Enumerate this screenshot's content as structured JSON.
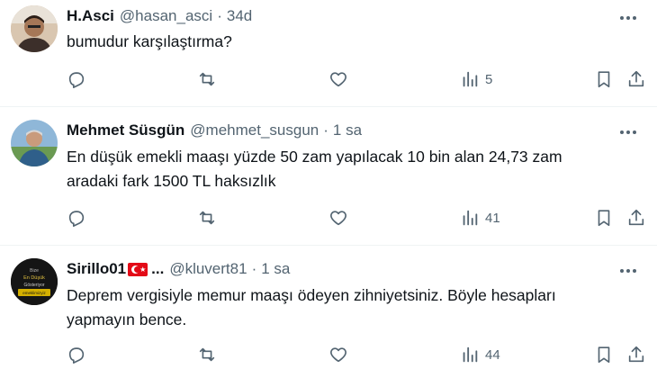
{
  "tweets": [
    {
      "name": "H.Asci",
      "handle": "@hasan_asci",
      "dot": "·",
      "time": "34d",
      "text": "bumudur karşılaştırma?",
      "views": "5"
    },
    {
      "name": "Mehmet Süsgün",
      "handle": "@mehmet_susgun",
      "dot": "·",
      "time": "1 sa",
      "text_line1": "En düşük emekli maaşı yüzde 50 zam yapılacak 10 bin alan 24,73 zam",
      "text_line2": "aradaki fark 1500 TL haksızlık",
      "views": "41"
    },
    {
      "name": "Sirillo01",
      "name_suffix": "...",
      "handle": "@kluvert81",
      "dot": "·",
      "time": "1 sa",
      "text_line1": "Deprem vergisiyle memur maaşı ödeyen zihniyetsiniz. Böyle hesapları",
      "text_line2": "yapmayın bence.",
      "views": "44",
      "avatar_lines": [
        "Bize",
        "En Düşük",
        "Gösteriyor",
        "emeklimizyiz"
      ]
    }
  ],
  "colors": {
    "text": "#0f1419",
    "muted": "#536471",
    "divider": "#eff3f4"
  },
  "icons": [
    "reply-icon",
    "retweet-icon",
    "like-icon",
    "views-icon",
    "bookmark-icon",
    "share-icon",
    "more-icon"
  ]
}
